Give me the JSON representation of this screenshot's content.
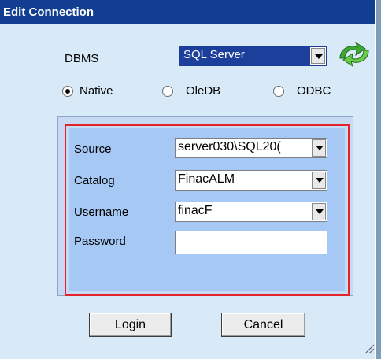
{
  "window": {
    "title": "Edit Connection"
  },
  "dbms": {
    "label": "DBMS",
    "selected": "SQL Server"
  },
  "connection_type": {
    "options": [
      {
        "label": "Native",
        "selected": true
      },
      {
        "label": "OleDB",
        "selected": false
      },
      {
        "label": "ODBC",
        "selected": false
      }
    ]
  },
  "form": {
    "source": {
      "label": "Source",
      "value": "server030\\SQL20("
    },
    "catalog": {
      "label": "Catalog",
      "value": "FinacALM"
    },
    "username": {
      "label": "Username",
      "value": "finacF"
    },
    "password": {
      "label": "Password",
      "value": ""
    }
  },
  "buttons": {
    "login": "Login",
    "cancel": "Cancel"
  },
  "colors": {
    "titlebar": "#123e92",
    "highlight": "#e2232b",
    "panel": "#a6c8f5"
  },
  "icons": {
    "refresh": "green-refresh-arrows-icon",
    "resize": "resize-grip-icon"
  }
}
